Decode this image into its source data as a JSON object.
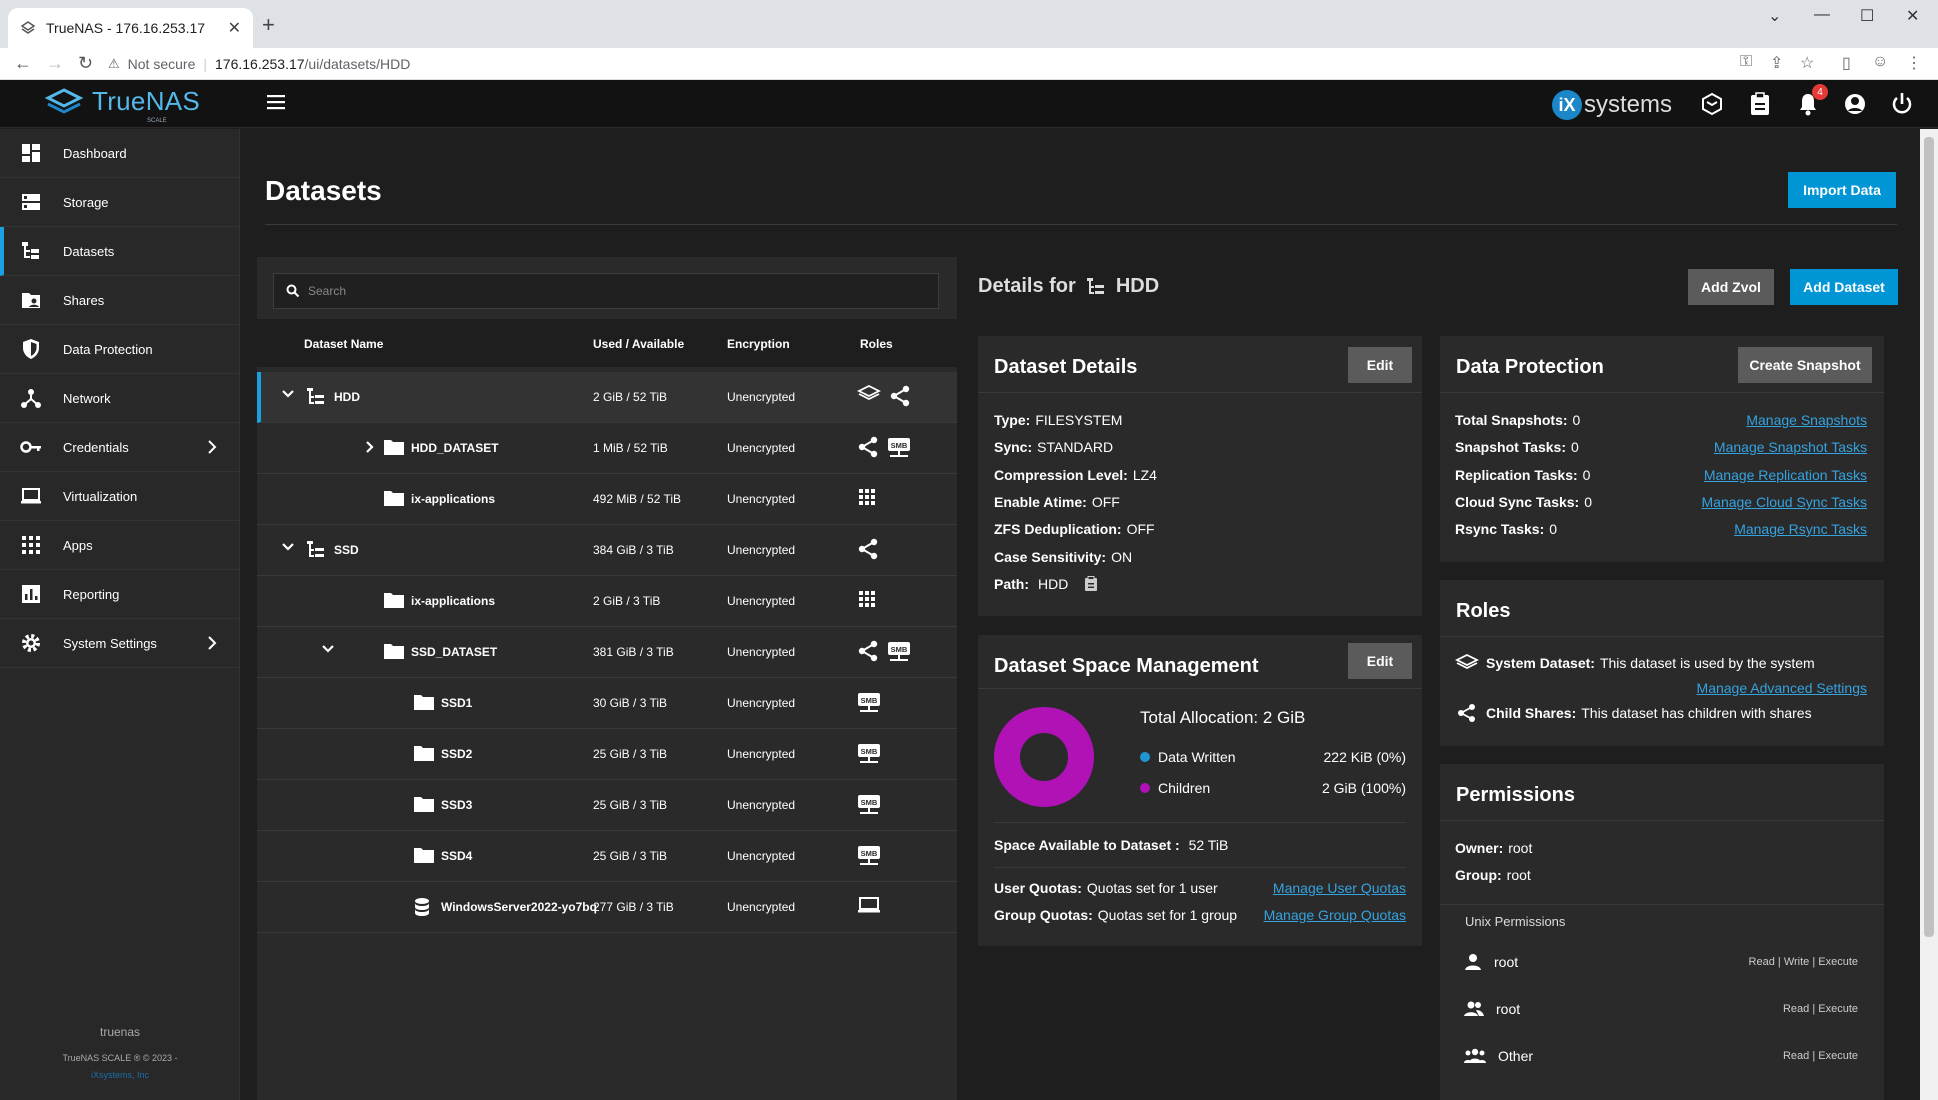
{
  "browser": {
    "tab_title": "TrueNAS - 176.16.253.17",
    "security": "Not secure",
    "url_host": "176.16.253.17",
    "url_path": "/ui/datasets/HDD"
  },
  "app": {
    "logo": "TrueNAS",
    "logo_sub": "SCALE",
    "vendor": "systems",
    "vendor_mark": "iX",
    "notif_count": "4"
  },
  "sidebar": {
    "items": [
      {
        "label": "Dashboard",
        "icon": "dashboard-icon"
      },
      {
        "label": "Storage",
        "icon": "storage-icon"
      },
      {
        "label": "Datasets",
        "icon": "datasets-icon"
      },
      {
        "label": "Shares",
        "icon": "shares-icon"
      },
      {
        "label": "Data Protection",
        "icon": "shield-icon"
      },
      {
        "label": "Network",
        "icon": "network-icon"
      },
      {
        "label": "Credentials",
        "icon": "key-icon"
      },
      {
        "label": "Virtualization",
        "icon": "laptop-icon"
      },
      {
        "label": "Apps",
        "icon": "apps-icon"
      },
      {
        "label": "Reporting",
        "icon": "reporting-icon"
      },
      {
        "label": "System Settings",
        "icon": "gear-icon"
      }
    ],
    "hostname": "truenas",
    "copyright": "TrueNAS SCALE ® © 2023 -",
    "company": "iXsystems, Inc"
  },
  "page": {
    "title": "Datasets",
    "import_label": "Import Data",
    "add_zvol": "Add Zvol",
    "add_dataset": "Add Dataset",
    "details_for": "Details for",
    "details_name": "HDD"
  },
  "tree": {
    "search_placeholder": "Search",
    "columns": [
      "Dataset Name",
      "Used / Available",
      "Encryption",
      "Roles"
    ],
    "rows": [
      {
        "name": "HDD",
        "used": "2 GiB / 52 TiB",
        "enc": "Unencrypted"
      },
      {
        "name": "HDD_DATASET",
        "used": "1 MiB / 52 TiB",
        "enc": "Unencrypted"
      },
      {
        "name": "ix-applications",
        "used": "492 MiB / 52 TiB",
        "enc": "Unencrypted"
      },
      {
        "name": "SSD",
        "used": "384 GiB / 3 TiB",
        "enc": "Unencrypted"
      },
      {
        "name": "ix-applications",
        "used": "2 GiB / 3 TiB",
        "enc": "Unencrypted"
      },
      {
        "name": "SSD_DATASET",
        "used": "381 GiB / 3 TiB",
        "enc": "Unencrypted"
      },
      {
        "name": "SSD1",
        "used": "30 GiB / 3 TiB",
        "enc": "Unencrypted"
      },
      {
        "name": "SSD2",
        "used": "25 GiB / 3 TiB",
        "enc": "Unencrypted"
      },
      {
        "name": "SSD3",
        "used": "25 GiB / 3 TiB",
        "enc": "Unencrypted"
      },
      {
        "name": "SSD4",
        "used": "25 GiB / 3 TiB",
        "enc": "Unencrypted"
      },
      {
        "name": "WindowsServer2022-yo7bq",
        "used": "277 GiB / 3 TiB",
        "enc": "Unencrypted"
      }
    ]
  },
  "details": {
    "title": "Dataset Details",
    "edit": "Edit",
    "type_k": "Type:",
    "type_v": "FILESYSTEM",
    "sync_k": "Sync:",
    "sync_v": "STANDARD",
    "comp_k": "Compression Level:",
    "comp_v": "LZ4",
    "atime_k": "Enable Atime:",
    "atime_v": "OFF",
    "dedup_k": "ZFS Deduplication:",
    "dedup_v": "OFF",
    "case_k": "Case Sensitivity:",
    "case_v": "ON",
    "path_k": "Path:",
    "path_v": "HDD"
  },
  "space": {
    "title": "Dataset Space Management",
    "edit": "Edit",
    "total_k": "Total Allocation:",
    "total_v": "2 GiB",
    "written_k": "Data Written",
    "written_v": "222 KiB (0%)",
    "children_k": "Children",
    "children_v": "2 GiB (100%)",
    "avail_k": "Space Available to Dataset :",
    "avail_v": "52 TiB",
    "uq_k": "User Quotas:",
    "uq_v": "Quotas set for 1 user",
    "uq_link": "Manage User Quotas",
    "gq_k": "Group Quotas:",
    "gq_v": "Quotas set for 1 group",
    "gq_link": "Manage Group Quotas",
    "written_color": "#1e96d6",
    "children_color": "#b012b6",
    "written_fraction": 0.0001
  },
  "protection": {
    "title": "Data Protection",
    "create": "Create Snapshot",
    "snap_k": "Total Snapshots:",
    "snap_v": "0",
    "snap_link": "Manage Snapshots",
    "stask_k": "Snapshot Tasks:",
    "stask_v": "0",
    "stask_link": "Manage Snapshot Tasks",
    "rep_k": "Replication Tasks:",
    "rep_v": "0",
    "rep_link": "Manage Replication Tasks",
    "cloud_k": "Cloud Sync Tasks:",
    "cloud_v": "0",
    "cloud_link": "Manage Cloud Sync Tasks",
    "rsync_k": "Rsync Tasks:",
    "rsync_v": "0",
    "rsync_link": "Manage Rsync Tasks"
  },
  "roles": {
    "title": "Roles",
    "sys_k": "System Dataset:",
    "sys_v": "This dataset is used by the system",
    "sys_link": "Manage Advanced Settings",
    "child_k": "Child Shares:",
    "child_v": "This dataset has children with shares"
  },
  "permissions": {
    "title": "Permissions",
    "owner_k": "Owner:",
    "owner_v": "root",
    "group_k": "Group:",
    "group_v": "root",
    "unix": "Unix Permissions",
    "entries": [
      {
        "who": "root",
        "access": "Read | Write | Execute"
      },
      {
        "who": "root",
        "access": "Read | Execute"
      },
      {
        "who": "Other",
        "access": "Read | Execute"
      }
    ]
  }
}
